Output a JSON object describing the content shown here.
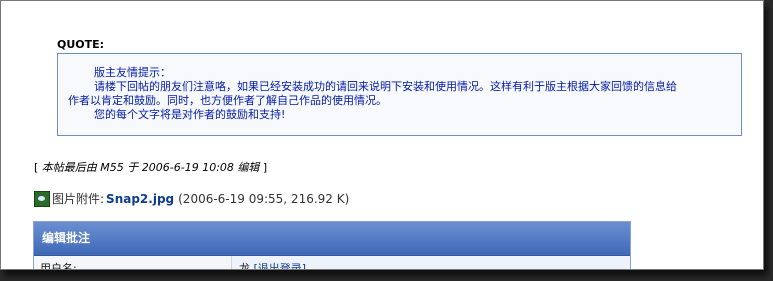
{
  "quote": {
    "label": "QUOTE:",
    "lines": [
      "版主友情提示：",
      "请楼下回帖的朋友们注意咯，如果已经安装成功的请回来说明下安装和使用情况。这样有利于版主根据大家回馈的信息给",
      "作者以肯定和鼓励。同时，也方便作者了解自己作品的使用情况。",
      "您的每个文字将是对作者的鼓励和支持!"
    ]
  },
  "edit_note": {
    "open": "[",
    "text": "本帖最后由 M55 于 2006-6-19 10:08 编辑",
    "close": "]"
  },
  "attachment": {
    "icon": "image-attachment-icon",
    "label": "图片附件:",
    "filename": "Snap2.jpg",
    "meta": "(2006-6-19 09:55, 216.92 K)"
  },
  "edit_panel": {
    "title": "编辑批注",
    "username_label": "用户名:",
    "username_value": "龙",
    "logout_label": "[退出登录]"
  }
}
